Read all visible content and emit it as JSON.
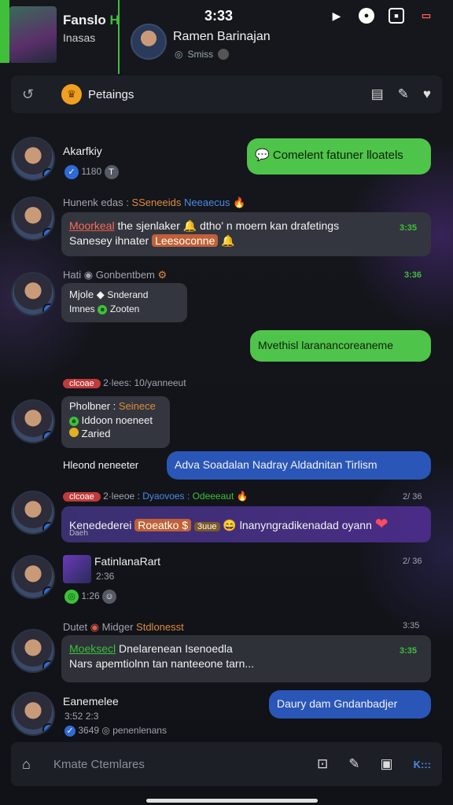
{
  "status": {
    "time": "3:33"
  },
  "header": {
    "app_title": "Fanslo",
    "app_title_accent": "H",
    "app_subtitle": "Inasas",
    "peer_name": "Ramen Barinajan",
    "peer_status": "Smiss"
  },
  "channel": {
    "name": "Petaings"
  },
  "messages": [
    {
      "nick": "Akarfkiy",
      "meta": "1180",
      "bubble": "Comelent fatuner lloatels"
    },
    {
      "meta_left": "Hunenk edas",
      "meta_orange": "SSeneeids",
      "meta_blue": "Neeaecus",
      "text_hl": "Moorkeal",
      "text_a": "the sjenlaker",
      "text_b": "dtho' n moern kan drafetings",
      "text_c": "Sanesey ihnater",
      "tag": "Leesoconne",
      "time": "3:35"
    },
    {
      "meta": "Hati",
      "meta_orange": "Gonbentbem",
      "line1": "Mjole",
      "line1b": "Snderand",
      "line2": "Imnes",
      "line2b": "Zooten",
      "time": "3:36"
    },
    {
      "bubble": "Mvethisl laranancoreaneme"
    },
    {
      "pill": "clcoae",
      "meta": "2·lees: 10/yanneeut"
    },
    {
      "nick": "Pholbner :",
      "nick_orange": "Seinece",
      "line1": "Iddoon noeneet",
      "line2": "Zaried"
    },
    {
      "nick": "Hleond neneeter",
      "bubble": "Adva Soadalan Nadray Aldadnitan Tirlism"
    },
    {
      "pill": "clcoae",
      "meta": "2·leeoe :",
      "meta_blue": "Dyaovoes :",
      "meta_green": "Odeeeaut",
      "name_left": "Kenedederei",
      "name_left2": "Daeh",
      "tag": "Roeatko $",
      "chip": "3uue",
      "text": "lnanyngradikenadad oyann",
      "time": "2/ 36"
    },
    {
      "nick": "FatinlanaRart",
      "meta": "2:36",
      "reaction_count": "1:26",
      "time": "2/ 36"
    },
    {
      "meta_left": "Dutet",
      "meta_mid": "Midger",
      "meta_orange": "Stdlonesst",
      "text_hl": "Moeksecl",
      "text_a": "Dnelarenean Isenoedla",
      "line2": "Nars apemtiolnn tan nanteeone tarn...",
      "time": "3:35"
    },
    {
      "nick": "Eanemelee",
      "meta": "3:52 2:3",
      "meta2": "3649",
      "meta2b": "penenlenans",
      "bubble": "Daury dam Gndanbadjer"
    }
  ],
  "composer": {
    "placeholder": "Kmate Ctemlares",
    "kbd": "K:::"
  },
  "colors": {
    "accent_green": "#3fbf3a",
    "bubble_blue": "#2a56b8",
    "bubble_purple": "#4a2c86"
  }
}
